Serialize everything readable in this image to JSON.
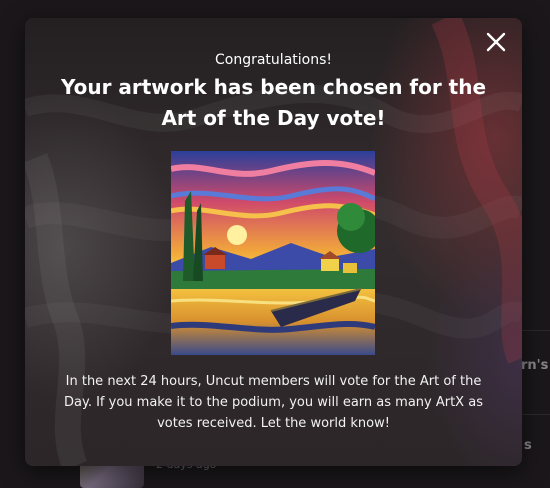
{
  "background": {
    "fragments": [
      "rn's",
      "s"
    ],
    "meta_text": "2 days ago"
  },
  "modal": {
    "congrats": "Congratulations!",
    "headline": "Your artwork has been chosen for the Art of the Day vote!",
    "artwork_image": "painting-village-lake-sunset",
    "description": "In the next 24 hours, Uncut members will vote for the Art of the Day. If you make it to the podium, you will earn as many ArtX as votes received. Let the world know!",
    "close_icon": "close-icon"
  },
  "colors": {
    "modal_bg": "#2a2527",
    "text": "#ffffff"
  }
}
